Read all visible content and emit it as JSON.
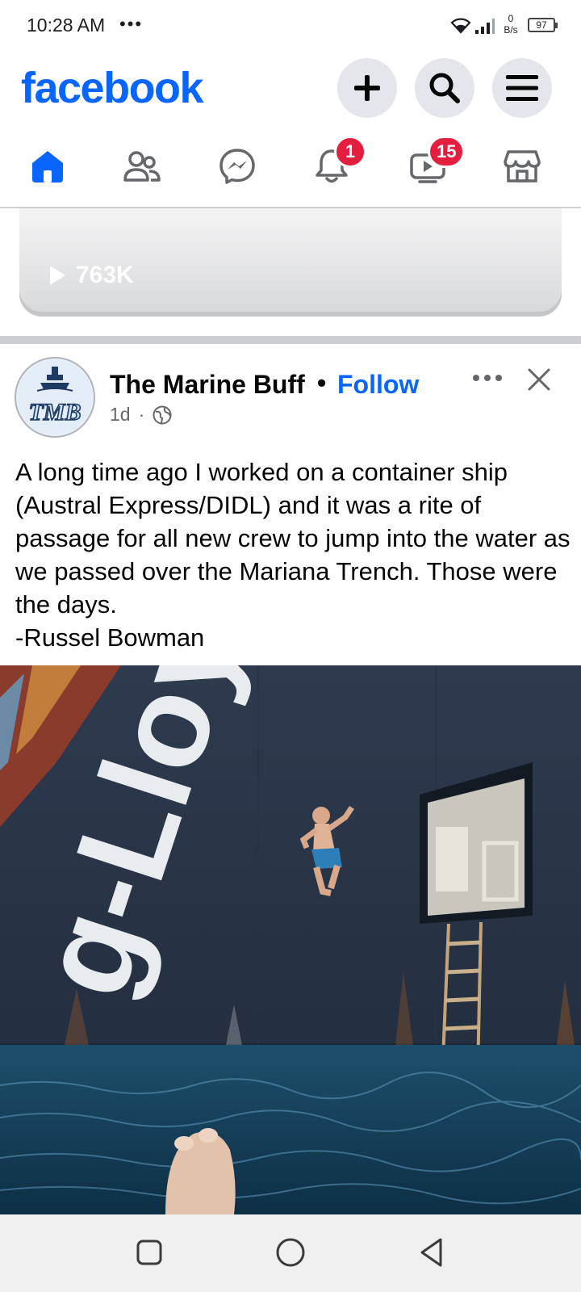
{
  "status_bar": {
    "time": "10:28 AM",
    "dots": "•••",
    "net_speed_top": "0",
    "net_speed_unit": "B/s",
    "battery": "97"
  },
  "header": {
    "logo": "facebook",
    "buttons": [
      "plus-icon",
      "search-icon",
      "menu-icon"
    ]
  },
  "nav": {
    "items": [
      "home",
      "friends",
      "messenger",
      "notifications",
      "video",
      "marketplace"
    ],
    "notifications_badge": "1",
    "video_badge": "15",
    "active": "home",
    "accent_color": "#0866ff",
    "badge_color": "#e41e3f"
  },
  "previous_post": {
    "views": "763K"
  },
  "post": {
    "author": "The Marine Buff",
    "dot": "•",
    "follow": "Follow",
    "time": "1d",
    "meta_sep": "·",
    "avatar_text": "TMB",
    "text": "A long time ago I worked on a container ship (Austral Express/DIDL) and it was a rite of passage for all new crew to jump into the water as we passed over the Mariana Trench. Those were the days.\n-Russel Bowman",
    "image_text": "g-Lloyd"
  }
}
